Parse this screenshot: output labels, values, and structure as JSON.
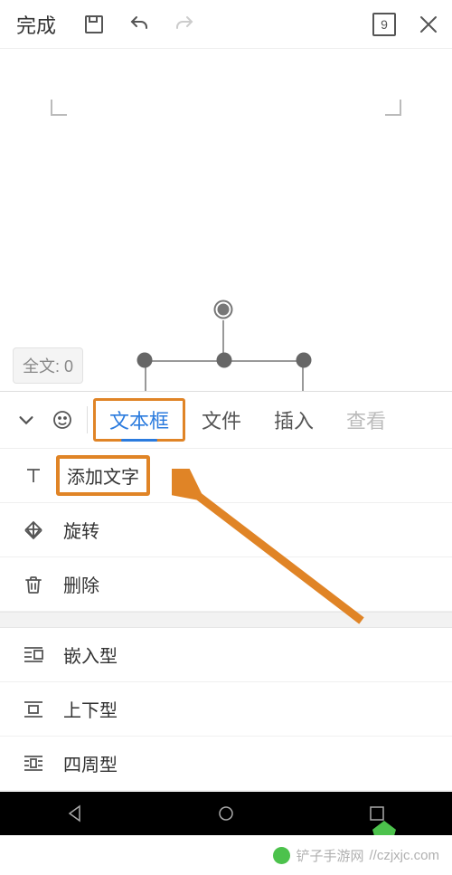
{
  "topbar": {
    "done_label": "完成",
    "page_number": "9"
  },
  "canvas": {
    "word_count_label": "全文: 0"
  },
  "tabs": {
    "items": [
      {
        "label": "文本框",
        "active": true
      },
      {
        "label": "文件",
        "active": false
      },
      {
        "label": "插入",
        "active": false
      },
      {
        "label": "查看",
        "active": false,
        "faded": true
      }
    ]
  },
  "panel": {
    "group1": [
      {
        "icon": "text-icon",
        "label": "添加文字",
        "highlight": true
      },
      {
        "icon": "rotate-icon",
        "label": "旋转"
      },
      {
        "icon": "delete-icon",
        "label": "删除"
      }
    ],
    "group2": [
      {
        "icon": "wrap-inline-icon",
        "label": "嵌入型"
      },
      {
        "icon": "wrap-topbottom-icon",
        "label": "上下型"
      },
      {
        "icon": "wrap-square-icon",
        "label": "四周型"
      }
    ]
  },
  "watermark": {
    "host": "//czjxjc.com",
    "brand": "铲子手游网"
  }
}
